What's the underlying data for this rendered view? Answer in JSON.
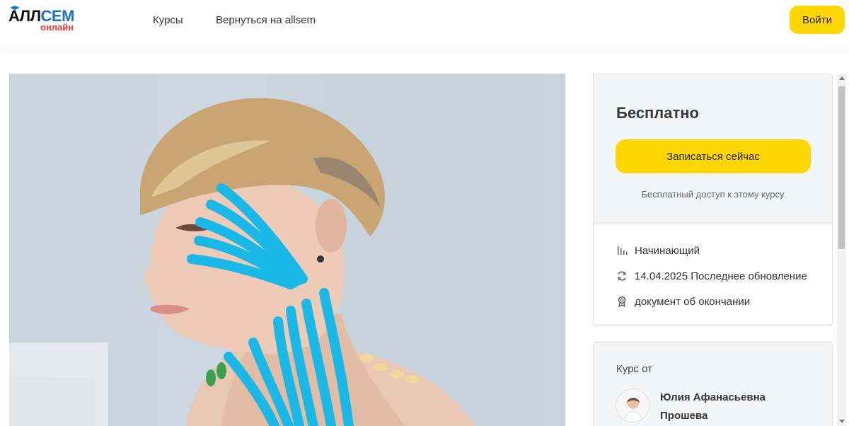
{
  "header": {
    "logo_top_left": "АЛЛ",
    "logo_top_right": "СЕМ",
    "logo_bottom": "онлайн",
    "nav": [
      {
        "label": "Курсы"
      },
      {
        "label": "Вернуться на allsem"
      }
    ],
    "login_label": "Войти"
  },
  "colors": {
    "accent": "#ffd700",
    "logo_blue": "#1a73c9",
    "logo_red": "#e53935",
    "tape": "#19b8e6"
  },
  "course_card": {
    "price": "Бесплатно",
    "enroll_label": "Записаться сейчас",
    "free_note": "Бесплатный доступ к этому курсу",
    "meta": [
      {
        "icon": "level-bars-icon",
        "text": "Начинающий"
      },
      {
        "icon": "refresh-icon",
        "text": "14.04.2025 Последнее обновление"
      },
      {
        "icon": "certificate-icon",
        "text": "документ об окончании"
      }
    ]
  },
  "instructor": {
    "by_label": "Курс от",
    "name_line1": "Юлия Афанасьевна",
    "name_line2": "Прошева"
  },
  "hero": {
    "image": "woman-with-blue-kinesio-tape-on-face-and-neck"
  }
}
